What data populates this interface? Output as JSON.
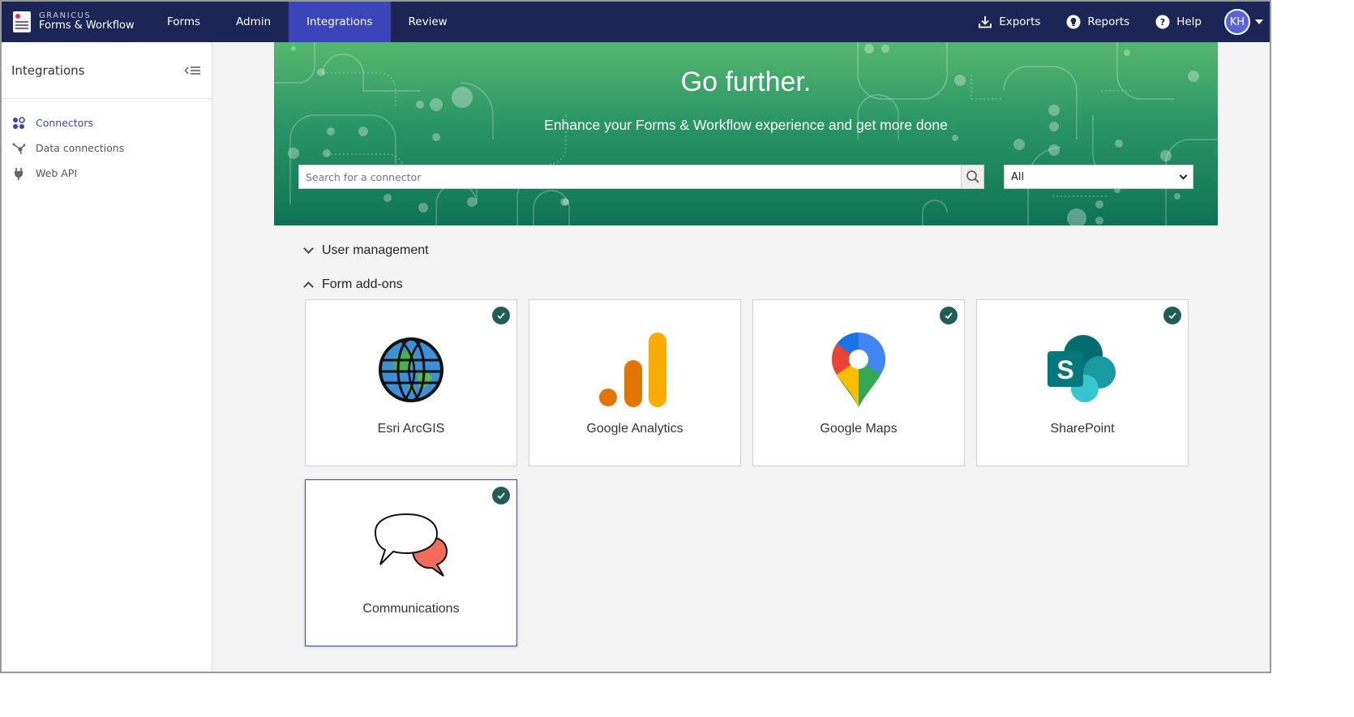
{
  "topbar": {
    "brand_top": "GRANICUS",
    "brand_bottom": "Forms & Workflow",
    "nav": [
      {
        "label": "Forms"
      },
      {
        "label": "Admin"
      },
      {
        "label": "Integrations"
      },
      {
        "label": "Review"
      }
    ],
    "active_nav": "Integrations",
    "tools": {
      "exports": "Exports",
      "reports": "Reports",
      "help": "Help"
    },
    "avatar_initials": "KH"
  },
  "sidebar": {
    "title": "Integrations",
    "items": [
      {
        "label": "Connectors",
        "icon": "connectors-icon",
        "active": true
      },
      {
        "label": "Data connections",
        "icon": "data-connections-icon",
        "active": false
      },
      {
        "label": "Web API",
        "icon": "plug-icon",
        "active": false
      }
    ]
  },
  "hero": {
    "title": "Go further.",
    "subtitle": "Enhance your Forms & Workflow experience and get more done",
    "search_placeholder": "Search for a connector",
    "filter_value": "All"
  },
  "sections": {
    "user_management": "User management",
    "form_addons": "Form add-ons"
  },
  "cards": [
    {
      "label": "Esri ArcGIS",
      "checked": true
    },
    {
      "label": "Google Analytics",
      "checked": false
    },
    {
      "label": "Google Maps",
      "checked": true
    },
    {
      "label": "SharePoint",
      "checked": true
    },
    {
      "label": "Communications",
      "checked": true
    }
  ],
  "colors": {
    "nav_bg": "#1b2556",
    "nav_active": "#3b44b8",
    "accent": "#3b44b8",
    "check_bg": "#1e5e56"
  }
}
